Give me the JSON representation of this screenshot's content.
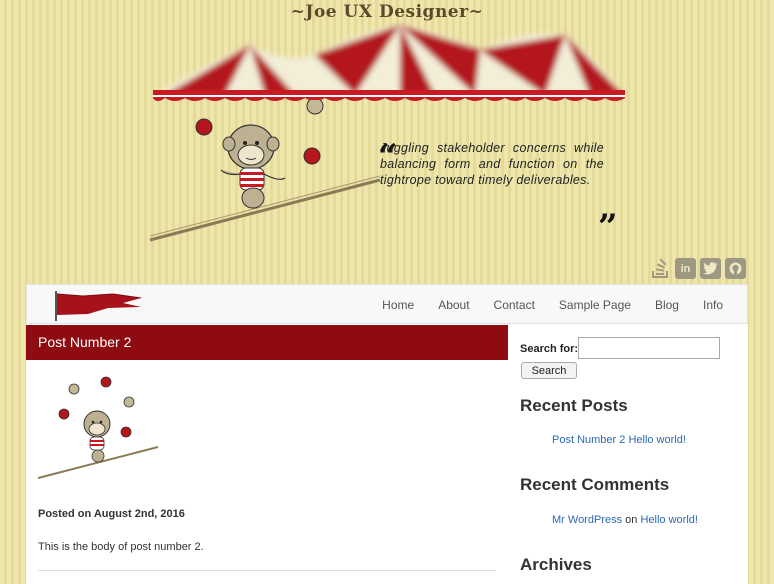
{
  "header": {
    "site_title": "~Joe UX Designer~",
    "quote": "Juggling stakeholder concerns while balancing form and function on the tightrope toward timely deliverables.",
    "quote_open": "“",
    "quote_close": "”"
  },
  "social": [
    {
      "icon": "stackoverflow-icon",
      "glyph": "≡"
    },
    {
      "icon": "linkedin-icon",
      "glyph": "in"
    },
    {
      "icon": "twitter-icon",
      "glyph": "⌂"
    },
    {
      "icon": "github-icon",
      "glyph": "●"
    }
  ],
  "nav": {
    "items": [
      "Home",
      "About",
      "Contact",
      "Sample Page",
      "Blog",
      "Info"
    ]
  },
  "post": {
    "title": "Post Number 2",
    "meta": "Posted on August 2nd, 2016",
    "body": "This is the body of post number 2."
  },
  "sidebar": {
    "search_label": "Search for:",
    "search_button": "Search",
    "search_value": "",
    "recent_posts_title": "Recent Posts",
    "recent_posts": [
      "Post Number 2",
      "Hello world!"
    ],
    "recent_comments_title": "Recent Comments",
    "comment_author": "Mr WordPress",
    "comment_on": "on",
    "comment_post": "Hello world!",
    "archives_title": "Archives"
  },
  "colors": {
    "accent": "#8f0b12",
    "link": "#2a69b6",
    "background": "#efe7b0"
  }
}
